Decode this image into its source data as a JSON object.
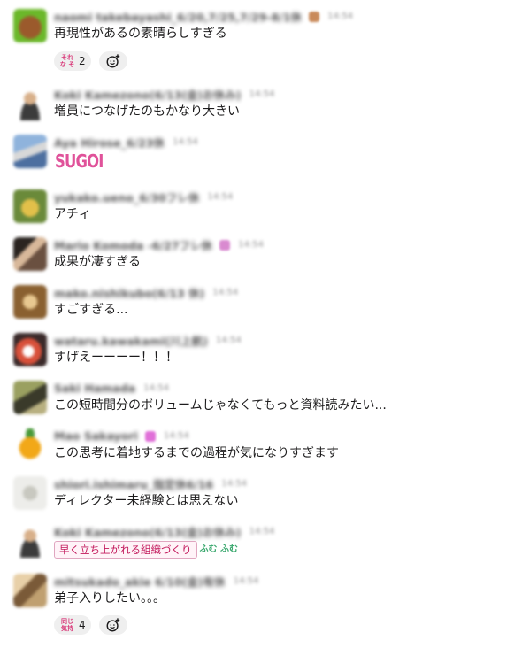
{
  "colors": {
    "background": "#ffffff",
    "text": "#1d1c1d",
    "reaction_bg": "#efefef",
    "tag_text": "#c2185b",
    "sugoi": "#e0529a"
  },
  "messages": [
    {
      "name": "naomi takebayashi_6/20,7/25,7/29-8/1休",
      "time": "14:54",
      "text": "再現性があるの素晴らしすぎる",
      "reactions": [
        {
          "emoji_text": "それな それ",
          "emoji": "sorena-emoji",
          "count": "2"
        }
      ]
    },
    {
      "name": "Koki Kamezono(6/13(金)お休み)",
      "time": "14:54",
      "text": "増員につなげたのもかなり大きい"
    },
    {
      "name": "Aya Hirose_6/23休",
      "time": "14:54",
      "sugoi": "SUGOI"
    },
    {
      "name": "yukako.ueno_6/30フレ休",
      "time": "14:54",
      "text": "アチィ"
    },
    {
      "name": "Mario Komoda -6/27フレ休",
      "time": "14:54",
      "text": "成果が凄すぎる"
    },
    {
      "name": "mako.nishikubo(6/13 休)",
      "time": "14:54",
      "text": "すごすぎる..."
    },
    {
      "name": "wataru.kawakami(川上航)",
      "time": "14:54",
      "text": "すげえーーーー！！！"
    },
    {
      "name": "Saki Hamada",
      "time": "14:54",
      "text": "この短時間分のボリュームじゃなくてもっと資料読みたい..."
    },
    {
      "name": "Mao Sakayori",
      "time": "14:54",
      "text": "この思考に着地するまでの過程が気になりすぎます"
    },
    {
      "name": "shiori.ishimaru_指定休6/16",
      "time": "14:54",
      "text": "ディレクター未経験とは思えない"
    },
    {
      "name": "Koki Kamezono(6/13(金)お休み)",
      "time": "14:54",
      "tag": "早く立ち上がれる組織づくり",
      "tag_emoji_text": "ふむ ふむ"
    },
    {
      "name": "mitsukado_akie 6/10(金)有休",
      "time": "14:54",
      "text": "弟子入りしたい。。。",
      "reactions": [
        {
          "emoji_text": "同じ気持ち",
          "emoji": "onaji-kimochi-emoji",
          "count": "4"
        }
      ]
    }
  ]
}
